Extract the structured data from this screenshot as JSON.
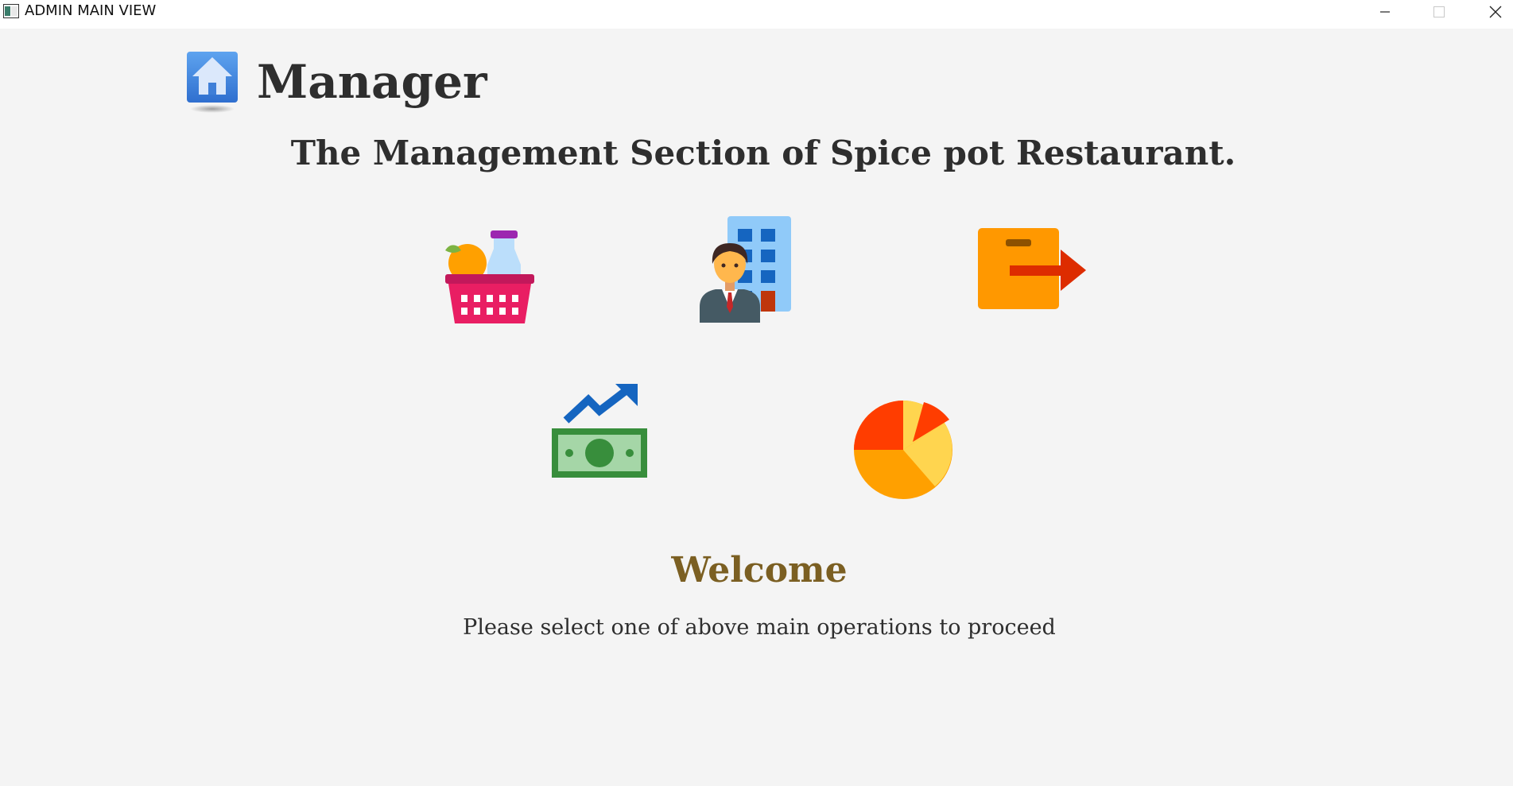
{
  "window": {
    "title": "ADMIN MAIN VIEW"
  },
  "header": {
    "title": "Manager",
    "subtitle": "The Management Section of Spice pot Restaurant."
  },
  "operations": [
    {
      "icon": "grocery-basket-icon"
    },
    {
      "icon": "employee-building-icon"
    },
    {
      "icon": "logout-box-icon"
    },
    {
      "icon": "money-growth-icon"
    },
    {
      "icon": "pie-chart-icon"
    }
  ],
  "welcome": {
    "heading": "Welcome",
    "message": "Please select one of above main operations to proceed"
  },
  "colors": {
    "background": "#f4f4f4",
    "title": "#2e2e2e",
    "welcome": "#7b5f22"
  }
}
